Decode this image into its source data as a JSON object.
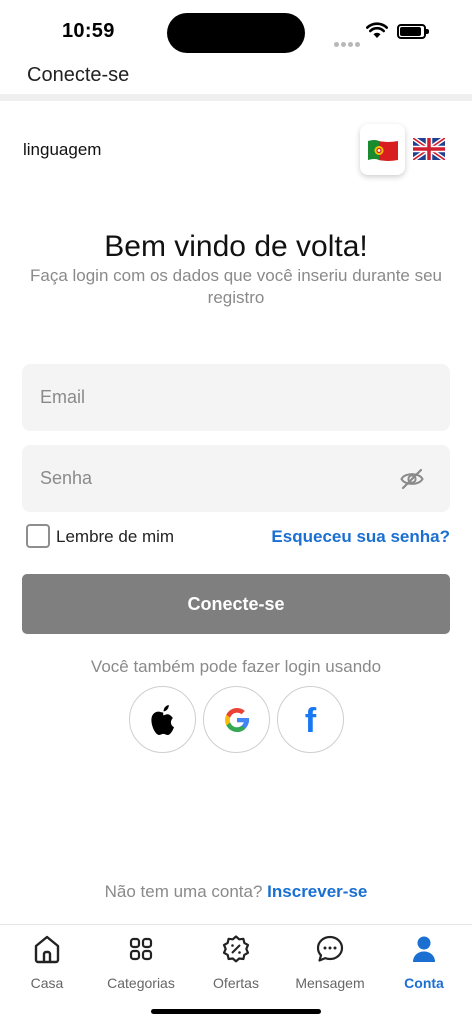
{
  "status": {
    "time": "10:59"
  },
  "header": {
    "title": "Conecte-se"
  },
  "language": {
    "label": "linguagem",
    "options": [
      "pt-flag",
      "uk-flag"
    ],
    "selected": "pt-flag"
  },
  "welcome": {
    "title": "Bem vindo de volta!",
    "subtitle": "Faça login com os dados que você inseriu durante seu registro"
  },
  "form": {
    "email_placeholder": "Email",
    "email_value": "",
    "password_placeholder": "Senha",
    "password_value": "",
    "remember_label": "Lembre de mim",
    "remember_checked": false,
    "forgot_label": "Esqueceu sua senha?",
    "login_label": "Conecte-se"
  },
  "social": {
    "caption": "Você também pode fazer login usando",
    "providers": [
      "apple-icon",
      "google-icon",
      "facebook-icon"
    ]
  },
  "signup": {
    "prompt": "Não tem uma conta?",
    "link": "Inscrever-se"
  },
  "tabs": [
    {
      "label": "Casa",
      "icon": "home-icon"
    },
    {
      "label": "Categorias",
      "icon": "grid-icon"
    },
    {
      "label": "Ofertas",
      "icon": "discount-badge-icon"
    },
    {
      "label": "Mensagem",
      "icon": "chat-icon"
    },
    {
      "label": "Conta",
      "icon": "user-icon",
      "active": true
    }
  ],
  "colors": {
    "accent": "#1a6fd1",
    "button": "#7f7f7f",
    "muted": "#8a8a8a",
    "input_bg": "#f4f4f4"
  }
}
